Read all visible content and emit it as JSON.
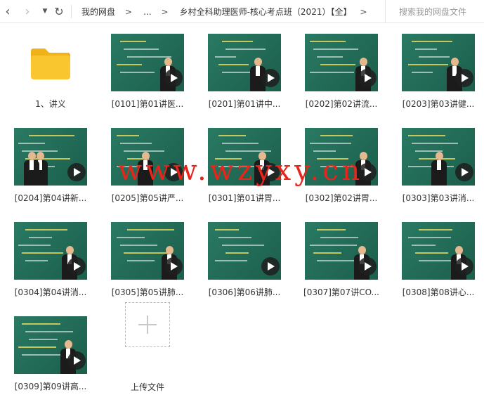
{
  "toolbar": {
    "back_icon": "chevron-left-icon",
    "forward_icon": "chevron-right-icon",
    "history_icon": "caret-down-icon",
    "refresh_icon": "refresh-icon",
    "breadcrumb": [
      "我的网盘",
      "...",
      "乡村全科助理医师-核心考点班（2021）【全】"
    ],
    "breadcrumb_sep": ">",
    "search_placeholder": "搜索我的网盘文件"
  },
  "items": [
    {
      "type": "folder",
      "label": "1、讲义"
    },
    {
      "type": "video",
      "label": "[0101]第01讲医..."
    },
    {
      "type": "video",
      "label": "[0201]第01讲中..."
    },
    {
      "type": "video",
      "label": "[0202]第02讲流..."
    },
    {
      "type": "video",
      "label": "[0203]第03讲健..."
    },
    {
      "type": "video",
      "label": "[0204]第04讲新..."
    },
    {
      "type": "video",
      "label": "[0205]第05讲严..."
    },
    {
      "type": "video",
      "label": "[0301]第01讲胃..."
    },
    {
      "type": "video",
      "label": "[0302]第02讲胃..."
    },
    {
      "type": "video",
      "label": "[0303]第03讲消..."
    },
    {
      "type": "video",
      "label": "[0304]第04讲消..."
    },
    {
      "type": "video",
      "label": "[0305]第05讲肺..."
    },
    {
      "type": "video",
      "label": "[0306]第06讲肺..."
    },
    {
      "type": "video",
      "label": "[0307]第07讲CO..."
    },
    {
      "type": "video",
      "label": "[0308]第08讲心..."
    },
    {
      "type": "video",
      "label": "[0309]第09讲高..."
    }
  ],
  "upload": {
    "label": "上传文件",
    "icon": "plus-icon"
  },
  "watermark": "www.wzyxy.cn",
  "colors": {
    "folder": "#f9c630",
    "board": "#1f6a56",
    "watermark": "#e8251b"
  }
}
